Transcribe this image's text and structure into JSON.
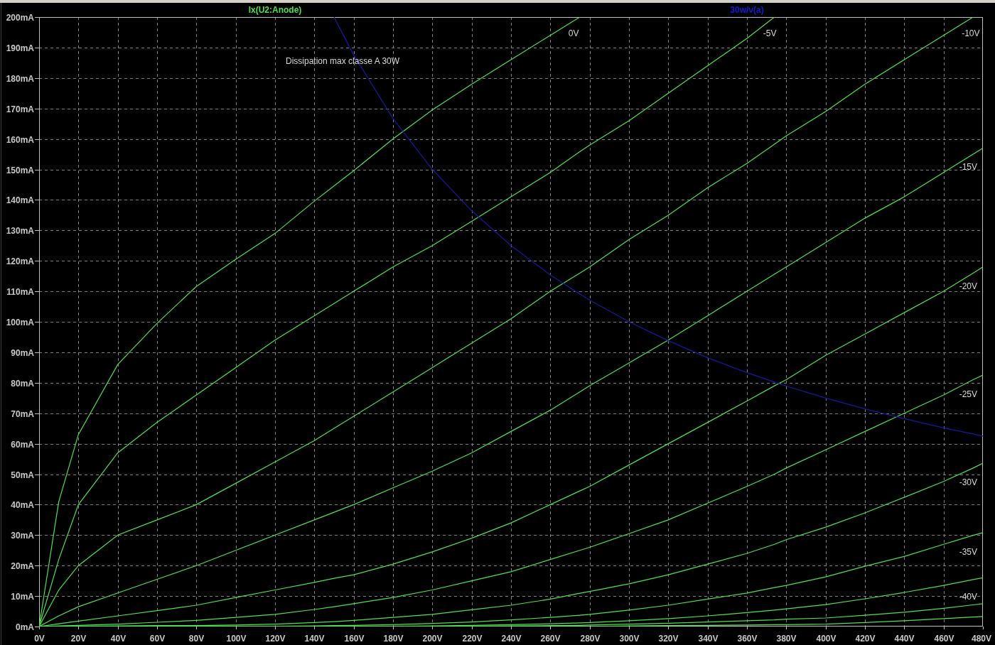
{
  "plot": {
    "trace_titles": [
      {
        "text": "Ix(U2:Anode)",
        "color": "#4ee04e"
      },
      {
        "text": "30w/v(a)",
        "color": "#1818d8"
      }
    ],
    "chart_data": {
      "type": "line",
      "grid": true,
      "x": [
        0,
        10,
        20,
        40,
        60,
        80,
        100,
        120,
        140,
        150,
        160,
        180,
        200,
        220,
        240,
        260,
        275,
        280,
        300,
        320,
        340,
        360,
        374,
        380,
        400,
        420,
        440,
        460,
        475,
        480
      ],
      "xlim": [
        0,
        480
      ],
      "ylim": [
        0,
        200
      ],
      "xticks": [
        {
          "value": 0,
          "label": "0V"
        },
        {
          "value": 20,
          "label": "20V"
        },
        {
          "value": 40,
          "label": "40V"
        },
        {
          "value": 60,
          "label": "60V"
        },
        {
          "value": 80,
          "label": "80V"
        },
        {
          "value": 100,
          "label": "100V"
        },
        {
          "value": 120,
          "label": "120V"
        },
        {
          "value": 140,
          "label": "140V"
        },
        {
          "value": 160,
          "label": "160V"
        },
        {
          "value": 180,
          "label": "180V"
        },
        {
          "value": 200,
          "label": "200V"
        },
        {
          "value": 220,
          "label": "220V"
        },
        {
          "value": 240,
          "label": "240V"
        },
        {
          "value": 260,
          "label": "260V"
        },
        {
          "value": 280,
          "label": "280V"
        },
        {
          "value": 300,
          "label": "300V"
        },
        {
          "value": 320,
          "label": "320V"
        },
        {
          "value": 340,
          "label": "340V"
        },
        {
          "value": 360,
          "label": "360V"
        },
        {
          "value": 380,
          "label": "380V"
        },
        {
          "value": 400,
          "label": "400V"
        },
        {
          "value": 420,
          "label": "420V"
        },
        {
          "value": 440,
          "label": "440V"
        },
        {
          "value": 460,
          "label": "460V"
        },
        {
          "value": 480,
          "label": "480V"
        }
      ],
      "yticks": [
        {
          "value": 0,
          "label": "0mA"
        },
        {
          "value": 10,
          "label": "10mA"
        },
        {
          "value": 20,
          "label": "20mA"
        },
        {
          "value": 30,
          "label": "30mA"
        },
        {
          "value": 40,
          "label": "40mA"
        },
        {
          "value": 50,
          "label": "50mA"
        },
        {
          "value": 60,
          "label": "60mA"
        },
        {
          "value": 70,
          "label": "70mA"
        },
        {
          "value": 80,
          "label": "80mA"
        },
        {
          "value": 90,
          "label": "90mA"
        },
        {
          "value": 100,
          "label": "100mA"
        },
        {
          "value": 110,
          "label": "110mA"
        },
        {
          "value": 120,
          "label": "120mA"
        },
        {
          "value": 130,
          "label": "130mA"
        },
        {
          "value": 140,
          "label": "140mA"
        },
        {
          "value": 150,
          "label": "150mA"
        },
        {
          "value": 160,
          "label": "160mA"
        },
        {
          "value": 170,
          "label": "170mA"
        },
        {
          "value": 180,
          "label": "180mA"
        },
        {
          "value": 190,
          "label": "190mA"
        },
        {
          "value": 200,
          "label": "200mA"
        }
      ],
      "series": [
        {
          "name": "0V",
          "color": "#4ee04e",
          "values": [
            0,
            41,
            63,
            86,
            99.5,
            111.6,
            120.5,
            129,
            139.6,
            144.6,
            149.6,
            160,
            169.5,
            178,
            186,
            194,
            200,
            null,
            null,
            null,
            null,
            null,
            null,
            null,
            null,
            null,
            null,
            null,
            null,
            null
          ]
        },
        {
          "name": "-5V",
          "color": "#4ee04e",
          "values": [
            0,
            22,
            40,
            57,
            67,
            76,
            85,
            94,
            102,
            106,
            110,
            118,
            125,
            133,
            141,
            149,
            155.8,
            158,
            166,
            175,
            184,
            193,
            200,
            null,
            null,
            null,
            null,
            null,
            null,
            null
          ]
        },
        {
          "name": "-10V",
          "color": "#4ee04e",
          "values": [
            0,
            12,
            20,
            30,
            35,
            40,
            47,
            54,
            61,
            65,
            69,
            77,
            85,
            93,
            101,
            110,
            116,
            118,
            127,
            135,
            144,
            152,
            158.3,
            161,
            169,
            178,
            186,
            194,
            200,
            null
          ]
        },
        {
          "name": "-15V",
          "color": "#4ee04e",
          "values": [
            0,
            3.5,
            6.5,
            11,
            15.5,
            20,
            25,
            30,
            35,
            37.5,
            40,
            45.5,
            51,
            57,
            64,
            71,
            77,
            79,
            86.5,
            94,
            102,
            110,
            115.6,
            118,
            126,
            134,
            141,
            149,
            155,
            157
          ]
        },
        {
          "name": "-20V",
          "color": "#4ee04e",
          "values": [
            0,
            0.9,
            1.8,
            3.5,
            5.2,
            7,
            9.5,
            12,
            14.5,
            15.8,
            17,
            20.5,
            24.5,
            29,
            34,
            40,
            44.5,
            46,
            53,
            60,
            67,
            74,
            79,
            81,
            89,
            96,
            103,
            110,
            116,
            118
          ]
        },
        {
          "name": "-25V",
          "color": "#4ee04e",
          "values": [
            0,
            0.2,
            0.4,
            0.8,
            1.4,
            2,
            3,
            4,
            5.6,
            6.5,
            7.5,
            9.5,
            12,
            15,
            18,
            22,
            25,
            26,
            30.5,
            35,
            40.5,
            46,
            50,
            52,
            58,
            64,
            70,
            76,
            81,
            82.5
          ]
        },
        {
          "name": "-30V",
          "color": "#4ee04e",
          "values": [
            0,
            0,
            0.1,
            0.2,
            0.3,
            0.3,
            0.5,
            0.8,
            1.3,
            1.6,
            2,
            3,
            4,
            5.5,
            7,
            9,
            10.9,
            11.5,
            14,
            17,
            20.5,
            24,
            27,
            28.5,
            32.6,
            37.3,
            42.4,
            47.6,
            52,
            53.6
          ]
        },
        {
          "name": "-35V",
          "color": "#4ee04e",
          "values": [
            0,
            0,
            0,
            0,
            0,
            0.1,
            0.1,
            0.1,
            0.2,
            0.3,
            0.4,
            0.6,
            1,
            1.5,
            2.2,
            3,
            3.7,
            4,
            5.4,
            7,
            9,
            11,
            12.8,
            13.5,
            16.3,
            19.8,
            23,
            27,
            29.9,
            30.8
          ]
        },
        {
          "name": "-40V",
          "color": "#4ee04e",
          "values": [
            0,
            0,
            0,
            0,
            0,
            0,
            0,
            0,
            0,
            0,
            0.1,
            0.1,
            0.2,
            0.4,
            0.6,
            0.9,
            1.2,
            1.3,
            1.9,
            2.6,
            3.5,
            4.6,
            5.4,
            5.8,
            7.2,
            9.1,
            11.2,
            13.5,
            15.4,
            16
          ]
        },
        {
          "color": "#4ee04e",
          "values": [
            0,
            0,
            0,
            0,
            0,
            0,
            0,
            0,
            0,
            0,
            0,
            0,
            0,
            0.1,
            0.2,
            0.3,
            0.4,
            0.5,
            0.8,
            1.1,
            1.5,
            1.9,
            2.2,
            2.4,
            2.8,
            3.7,
            4.7,
            6,
            7.1,
            7.5
          ]
        },
        {
          "color": "#4ee04e",
          "values": [
            0,
            0,
            0,
            0,
            0,
            0,
            0,
            0,
            0,
            0,
            0,
            0,
            0,
            0,
            0,
            0,
            0,
            0,
            0.2,
            0.3,
            0.4,
            0.5,
            0.6,
            0.6,
            0.8,
            1.3,
            1.9,
            2.6,
            3.1,
            3.3
          ]
        },
        {
          "color": "#1818a0",
          "values": [
            null,
            null,
            null,
            null,
            null,
            null,
            null,
            null,
            null,
            200,
            187.5,
            166.7,
            150,
            136.4,
            125,
            115.4,
            109.1,
            107.1,
            100,
            93.8,
            88.2,
            83.3,
            80.2,
            78.9,
            75,
            71.4,
            68.2,
            65.2,
            63.2,
            62.5
          ]
        }
      ],
      "annotations": [
        "Dissipation max classe A 30W"
      ]
    }
  }
}
